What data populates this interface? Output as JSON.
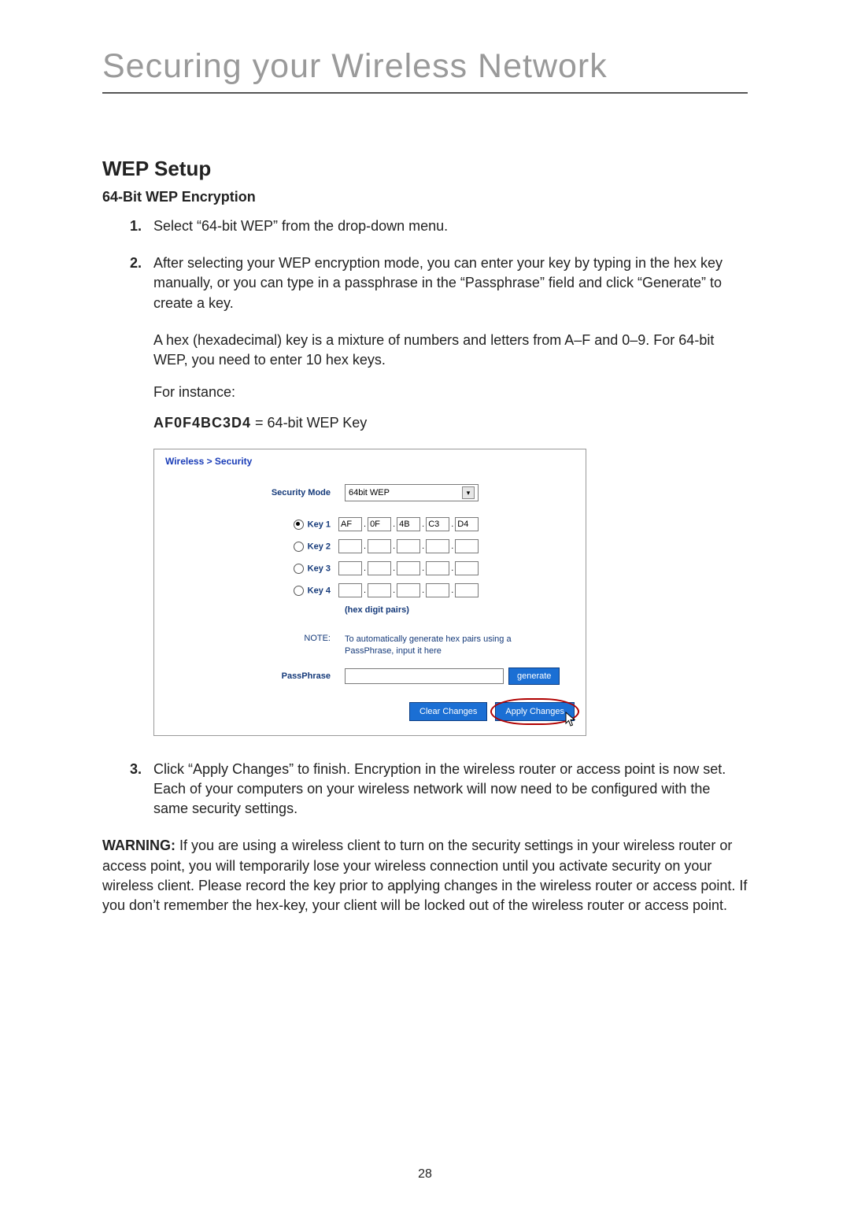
{
  "page_title": "Securing your Wireless Network",
  "section_heading": "WEP Setup",
  "sub_heading": "64-Bit WEP Encryption",
  "step1": "Select “64-bit WEP” from the drop-down menu.",
  "step2": "After selecting your WEP encryption mode, you can enter your key by typing in the hex key manually, or you can type in a passphrase in the “Passphrase” field and click “Generate” to create a key.",
  "para2a": "A hex (hexadecimal) key is a mixture of numbers and letters from A–F and 0–9. For 64-bit WEP, you need to enter 10 hex keys.",
  "para2b": "For instance:",
  "key_example_bold": "AF0F4BC3D4",
  "key_example_rest": " = 64-bit WEP Key",
  "step3": "Click “Apply Changes” to finish. Encryption in the wireless router or access point is now set. Each of your computers on your wireless network will now need to be configured with the same security settings.",
  "warning_label": "WARNING:",
  "warning_text": " If you are using a wireless client to turn on the security settings in your wireless router or access point, you will temporarily lose your wireless connection until you activate security on your wireless client. Please record the key prior to applying changes in the wireless router or access point. If you don’t remember the hex-key, your client will be locked out of the wireless router or access point.",
  "page_number": "28",
  "ui": {
    "breadcrumb": "Wireless > Security",
    "security_mode_label": "Security Mode",
    "security_mode_value": "64bit WEP",
    "keys": [
      {
        "label": "Key 1",
        "selected": true,
        "v": [
          "AF",
          "0F",
          "4B",
          "C3",
          "D4"
        ]
      },
      {
        "label": "Key 2",
        "selected": false,
        "v": [
          "",
          "",
          "",
          "",
          ""
        ]
      },
      {
        "label": "Key 3",
        "selected": false,
        "v": [
          "",
          "",
          "",
          "",
          ""
        ]
      },
      {
        "label": "Key 4",
        "selected": false,
        "v": [
          "",
          "",
          "",
          "",
          ""
        ]
      }
    ],
    "hex_note": "(hex digit pairs)",
    "note_label": "NOTE:",
    "note_text": "To automatically generate hex pairs using a PassPhrase, input it here",
    "passphrase_label": "PassPhrase",
    "generate_btn": "generate",
    "clear_btn": "Clear Changes",
    "apply_btn": "Apply Changes"
  }
}
